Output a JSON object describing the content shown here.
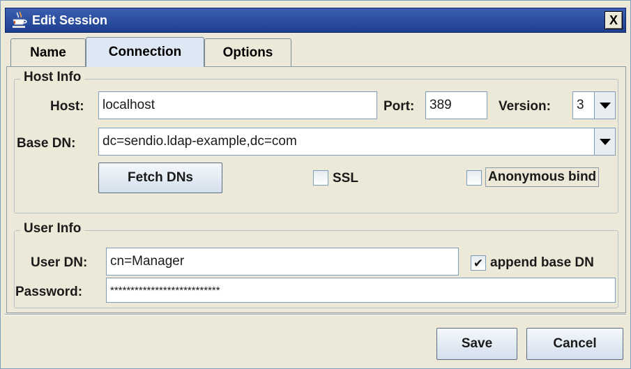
{
  "window": {
    "title": "Edit Session",
    "close_glyph": "X",
    "icon": "java-cup-icon"
  },
  "tabs": [
    {
      "label": "Name",
      "selected": false
    },
    {
      "label": "Connection",
      "selected": true
    },
    {
      "label": "Options",
      "selected": false
    }
  ],
  "host_info": {
    "legend": "Host Info",
    "host_label": "Host:",
    "host_value": "localhost",
    "port_label": "Port:",
    "port_value": "389",
    "version_label": "Version:",
    "version_value": "3",
    "base_dn_label": "Base DN:",
    "base_dn_value": "dc=sendio.ldap-example,dc=com",
    "fetch_button": "Fetch DNs",
    "ssl_label": "SSL",
    "ssl_checked": false,
    "anon_label": "Anonymous bind",
    "anon_checked": false
  },
  "user_info": {
    "legend": "User Info",
    "user_dn_label": "User DN:",
    "user_dn_value": "cn=Manager",
    "append_label": "append base DN",
    "append_checked": true,
    "append_mark": "✔",
    "password_label": "Password:",
    "password_value": "***************************"
  },
  "footer": {
    "save_label": "Save",
    "cancel_label": "Cancel"
  },
  "colors": {
    "title_bar": "#2a4ea0",
    "active_tab": "#dde8f4",
    "dialog_bg": "#ece9d8"
  }
}
